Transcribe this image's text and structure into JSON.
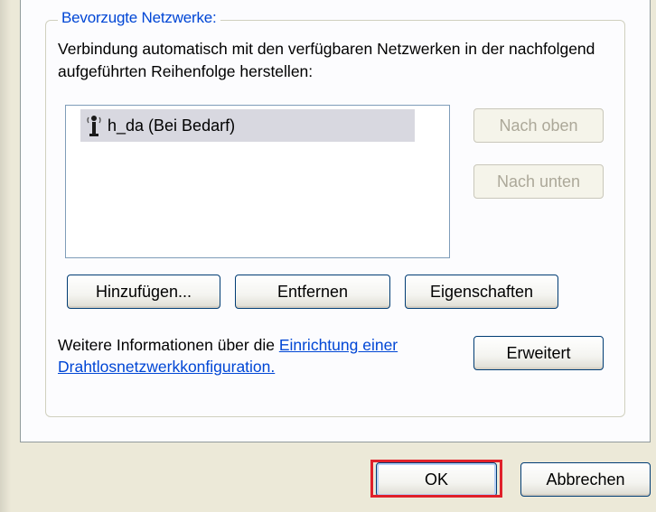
{
  "groupbox": {
    "legend": "Bevorzugte Netzwerke:",
    "description": "Verbindung automatisch mit den verfügbaren Netzwerken in der nachfolgend aufgeführten Reihenfolge herstellen:"
  },
  "network_list": {
    "items": [
      {
        "label": "h_da (Bei Bedarf)",
        "icon": "wireless-network-icon",
        "selected": true
      }
    ]
  },
  "buttons": {
    "move_up": "Nach oben",
    "move_down": "Nach unten",
    "add": "Hinzufügen...",
    "remove": "Entfernen",
    "properties": "Eigenschaften",
    "advanced": "Erweitert",
    "ok": "OK",
    "cancel": "Abbrechen"
  },
  "info": {
    "text": "Weitere Informationen über die ",
    "link": "Einrichtung einer Drahtlosnetzwerkkonfiguration."
  },
  "colors": {
    "legend": "#0046d5",
    "link": "#0046d5",
    "highlight": "#e0202a",
    "dialog_bg": "#ece9d8",
    "panel_bg": "#fcfcfe"
  }
}
